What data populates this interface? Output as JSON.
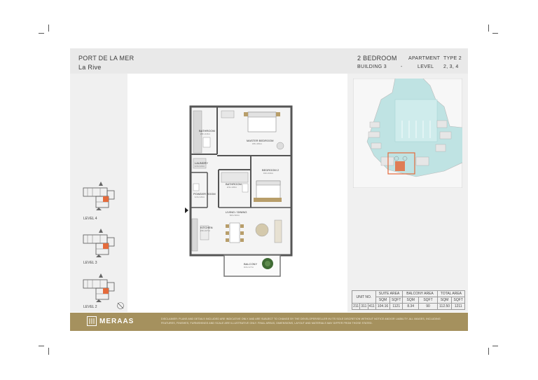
{
  "header": {
    "project": "PORT DE LA MER",
    "subproject": "La Rive",
    "unit_type": "2 BEDROOM",
    "building": "BUILDING 3",
    "separator": "-",
    "apartment_label": "APARTMENT",
    "apartment_value": "TYPE 2",
    "level_label": "LEVEL",
    "level_value": "2, 3, 4"
  },
  "levels": [
    "LEVEL 4",
    "LEVEL 3",
    "LEVEL 2"
  ],
  "rooms": {
    "bathroom1": "BATHROOM",
    "bathroom1_dim": "2.6 x 1.9 m",
    "master": "MASTER BEDROOM",
    "master_dim": "4.5 x 3.6 m",
    "laundry": "LAUNDRY",
    "laundry_dim": "1.3 x 1.3 m",
    "bathroom2": "BATHROOM",
    "bathroom2_dim": "2.3 x 1.8 m",
    "bedroom2": "BEDROOM 2",
    "bedroom2_dim": "3.4 x 3.4 m",
    "powder": "POWDER ROOM",
    "powder_dim": "1.3 x 1.9 m",
    "living": "LIVING / DINING",
    "living_dim": "6.0 x 6.3 m",
    "kitchen": "KITCHEN",
    "kitchen_dim": "2.9 x 3.7 m",
    "balcony": "BALCONY",
    "balcony_dim": "3.4 x 1.7 m"
  },
  "table": {
    "unit_no_label": "UNIT NO.",
    "suite_area_label": "SUITE AREA",
    "balcony_area_label": "BALCONY AREA",
    "total_area_label": "TOTAL AREA",
    "sqm": "SQM",
    "sqft": "SQFT",
    "units": [
      "211",
      "311",
      "411"
    ],
    "suite_sqm": "104.16",
    "suite_sqft": "1121",
    "balcony_sqm": "8.34",
    "balcony_sqft": "90",
    "total_sqm": "112.50",
    "total_sqft": "1211"
  },
  "footer": {
    "brand": "MERAAS",
    "disclaimer": "DISCLAIMER: PLANS AND DETAILS INCLUDED ARE INDICATIVE ONLY AND ARE SUBJECT TO CHANGE BY THE DEVELOPER/SELLER IN ITS SOLE DISCRETION WITHOUT NOTICE AND/OR LIABILITY. ALL IMAGES, INCLUDING FEATURES, FINISHES, FURNISHINGS AND SCALE ARE ILLUSTRATIVE ONLY. FINAL AREAS, DIMENSIONS, LAYOUT AND MATERIALS MAY DIFFER FROM THOSE STATED."
  },
  "colors": {
    "footer_gold": "#a5915e",
    "water": "#bfe3e3",
    "highlight": "#e46b3c"
  }
}
